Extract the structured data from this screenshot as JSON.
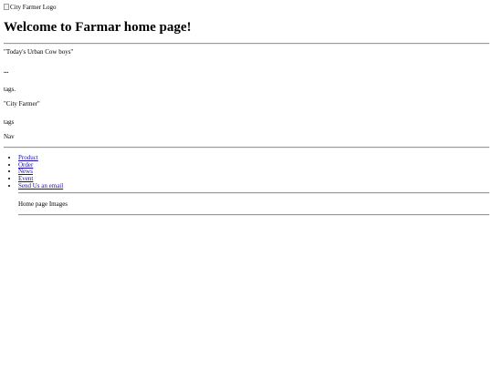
{
  "header": {
    "logo_alt": "City Farmer Logo",
    "title": "Welcome to Farmar home page!"
  },
  "intro": {
    "tagline": "\"Today's Urban Cow boys\"",
    "dots": "...",
    "tags_text_1": "tags.",
    "city_farmer": "\"City Farmer\"",
    "tags_text_2": "tags",
    "nav_label": "Nav"
  },
  "nav": {
    "items": [
      {
        "label": "Product"
      },
      {
        "label": "Order"
      },
      {
        "label": "News"
      },
      {
        "label": "Event"
      },
      {
        "label": "Send Us an email"
      }
    ]
  },
  "images_section": {
    "label": "Home page Images"
  }
}
